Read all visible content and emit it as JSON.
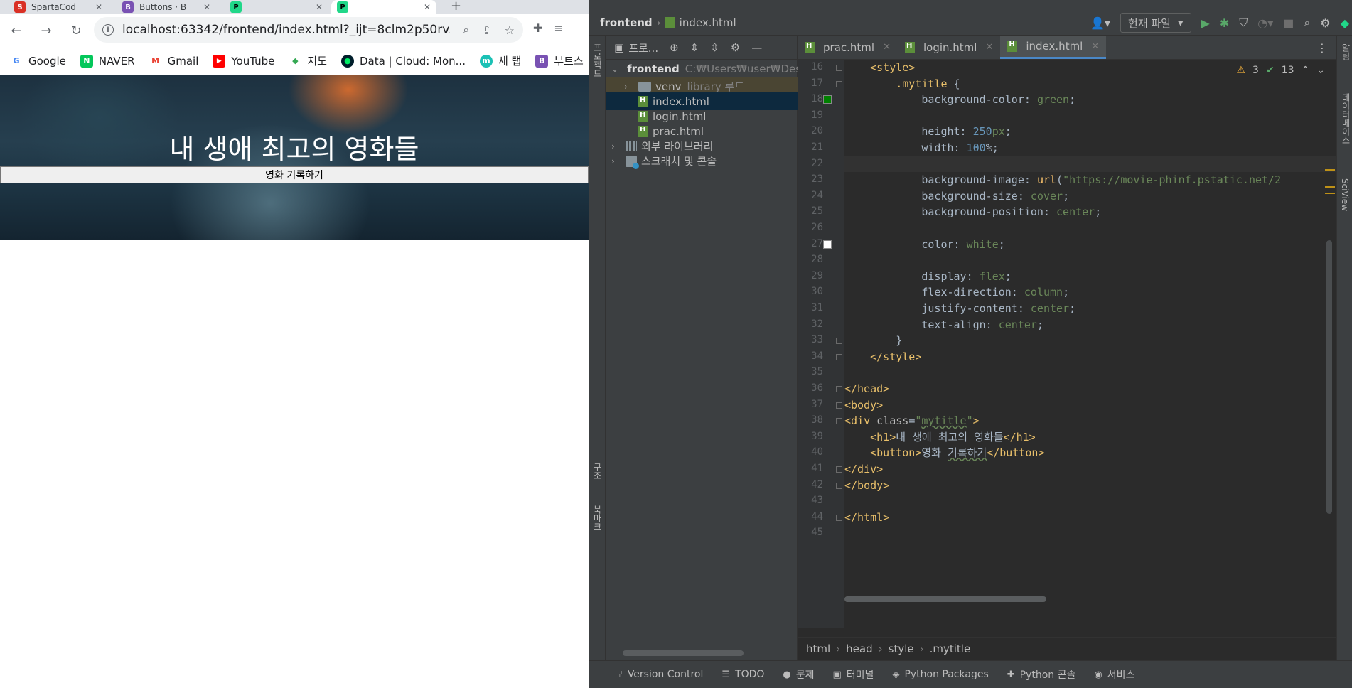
{
  "browser": {
    "tabs": [
      {
        "label": "SpartaCod",
        "color": "#d93025",
        "glyph": "S"
      },
      {
        "label": "Buttons · B",
        "color": "#7952b3",
        "glyph": "B"
      },
      {
        "label": "",
        "color": "#21d789",
        "glyph": "P"
      },
      {
        "label": "",
        "color": "#21d789",
        "glyph": "P"
      }
    ],
    "new_tab": "+",
    "url": "localhost:63342/frontend/index.html?_ijt=8clm2p50rv...",
    "bookmarks": [
      {
        "label": "Google",
        "color": "#4285f4",
        "glyph": "G"
      },
      {
        "label": "NAVER",
        "color": "#03c75a",
        "glyph": "N"
      },
      {
        "label": "Gmail",
        "color": "#ea4335",
        "glyph": "M"
      },
      {
        "label": "YouTube",
        "color": "#ff0000",
        "glyph": "▶"
      },
      {
        "label": "지도",
        "color": "#34a853",
        "glyph": "◆"
      },
      {
        "label": "Data | Cloud: Mon...",
        "color": "#00684a",
        "glyph": "●"
      },
      {
        "label": "새 탭",
        "color": "#1bc1b5",
        "glyph": "m"
      },
      {
        "label": "부트스",
        "color": "#7952b3",
        "glyph": "B"
      }
    ]
  },
  "webpage": {
    "title": "내 생애 최고의 영화들",
    "button": "영화 기록하기"
  },
  "ide": {
    "project_name": "frontend",
    "current_file": "index.html",
    "run_config": "현재 파일",
    "project_panel_title": "프로...",
    "left_stripe_labels": [
      "프로젝트",
      "구조",
      "북마크"
    ],
    "right_stripe_labels": [
      "알림",
      "데이터베이스",
      "SciView"
    ],
    "tree": [
      {
        "label": "frontend",
        "extra": "C:₩Users₩user₩Deskt",
        "type": "folder",
        "depth": 0,
        "open": true
      },
      {
        "label": "venv",
        "extra": "library 루트",
        "type": "folder",
        "depth": 1,
        "open": false
      },
      {
        "label": "index.html",
        "extra": "",
        "type": "file",
        "depth": 2,
        "selected": true
      },
      {
        "label": "login.html",
        "extra": "",
        "type": "file",
        "depth": 2
      },
      {
        "label": "prac.html",
        "extra": "",
        "type": "file",
        "depth": 2
      },
      {
        "label": "외부 라이브러리",
        "extra": "",
        "type": "lib",
        "depth": 0
      },
      {
        "label": "스크래치 및 콘솔",
        "extra": "",
        "type": "scratch",
        "depth": 0
      }
    ],
    "editor_tabs": [
      "prac.html",
      "login.html",
      "index.html"
    ],
    "active_tab": "index.html",
    "inspections": {
      "warnings": "3",
      "ok": "13"
    },
    "breadcrumb": [
      "html",
      "head",
      "style",
      ".mytitle"
    ],
    "code_lines": [
      {
        "n": "16",
        "html": "    <span class='t-tag'>&lt;style&gt;</span>"
      },
      {
        "n": "17",
        "html": "        <span class='t-sel'>.mytitle</span> {"
      },
      {
        "n": "18",
        "html": "            background-color: <span class='t-val'>green</span>;"
      },
      {
        "n": "19",
        "html": ""
      },
      {
        "n": "20",
        "html": "            height: <span class='t-num'>250</span><span class='t-val'>px</span>;"
      },
      {
        "n": "21",
        "html": "            width: <span class='t-num'>100</span>%;"
      },
      {
        "n": "22",
        "html": ""
      },
      {
        "n": "23",
        "html": "            background-image: <span class='t-fn'>url</span>(<span class='t-str'>\"https://movie-phinf.pstatic.net/2</span>"
      },
      {
        "n": "24",
        "html": "            background-size: <span class='t-val'>cover</span>;"
      },
      {
        "n": "25",
        "html": "            background-position: <span class='t-val'>center</span>;"
      },
      {
        "n": "26",
        "html": ""
      },
      {
        "n": "27",
        "html": "            color: <span class='t-val'>white</span>;"
      },
      {
        "n": "28",
        "html": ""
      },
      {
        "n": "29",
        "html": "            display: <span class='t-val'>flex</span>;"
      },
      {
        "n": "30",
        "html": "            flex-direction: <span class='t-val'>column</span>;"
      },
      {
        "n": "31",
        "html": "            justify-content: <span class='t-val'>center</span>;"
      },
      {
        "n": "32",
        "html": "            text-align: <span class='t-val'>center</span>;"
      },
      {
        "n": "33",
        "html": "        }"
      },
      {
        "n": "34",
        "html": "    <span class='t-tag'>&lt;/style&gt;</span>"
      },
      {
        "n": "35",
        "html": ""
      },
      {
        "n": "36",
        "html": "<span class='t-tag'>&lt;/head&gt;</span>"
      },
      {
        "n": "37",
        "html": "<span class='t-tag'>&lt;body&gt;</span>"
      },
      {
        "n": "38",
        "html": "<span class='t-tag'>&lt;div </span><span class='t-attr'>class</span>=<span class='t-str'>\"<span class='u-wavy'>mytitle</span>\"</span><span class='t-tag'>&gt;</span>"
      },
      {
        "n": "39",
        "html": "    <span class='t-tag'>&lt;h1&gt;</span>내 생애 최고의 영화들<span class='t-tag'>&lt;/h1&gt;</span>"
      },
      {
        "n": "40",
        "html": "    <span class='t-tag'>&lt;button&gt;</span>영화 <span class='u-wavy'>기록하기</span><span class='t-tag'>&lt;/button&gt;</span>"
      },
      {
        "n": "41",
        "html": "<span class='t-tag'>&lt;/div&gt;</span>"
      },
      {
        "n": "42",
        "html": "<span class='t-tag'>&lt;/body&gt;</span>"
      },
      {
        "n": "43",
        "html": ""
      },
      {
        "n": "44",
        "html": "<span class='t-tag'>&lt;/html&gt;</span>"
      },
      {
        "n": "45",
        "html": ""
      }
    ],
    "swatches": [
      {
        "line": "18",
        "color": "#008000"
      },
      {
        "line": "27",
        "color": "#ffffff"
      }
    ],
    "current_line": "22",
    "bottom_tools": [
      {
        "label": "Version Control",
        "icon": "⑂"
      },
      {
        "label": "TODO",
        "icon": "☰"
      },
      {
        "label": "문제",
        "icon": "●"
      },
      {
        "label": "터미널",
        "icon": "▣"
      },
      {
        "label": "Python Packages",
        "icon": "◈"
      },
      {
        "label": "Python 콘솔",
        "icon": "✚"
      },
      {
        "label": "서비스",
        "icon": "◉"
      }
    ]
  }
}
